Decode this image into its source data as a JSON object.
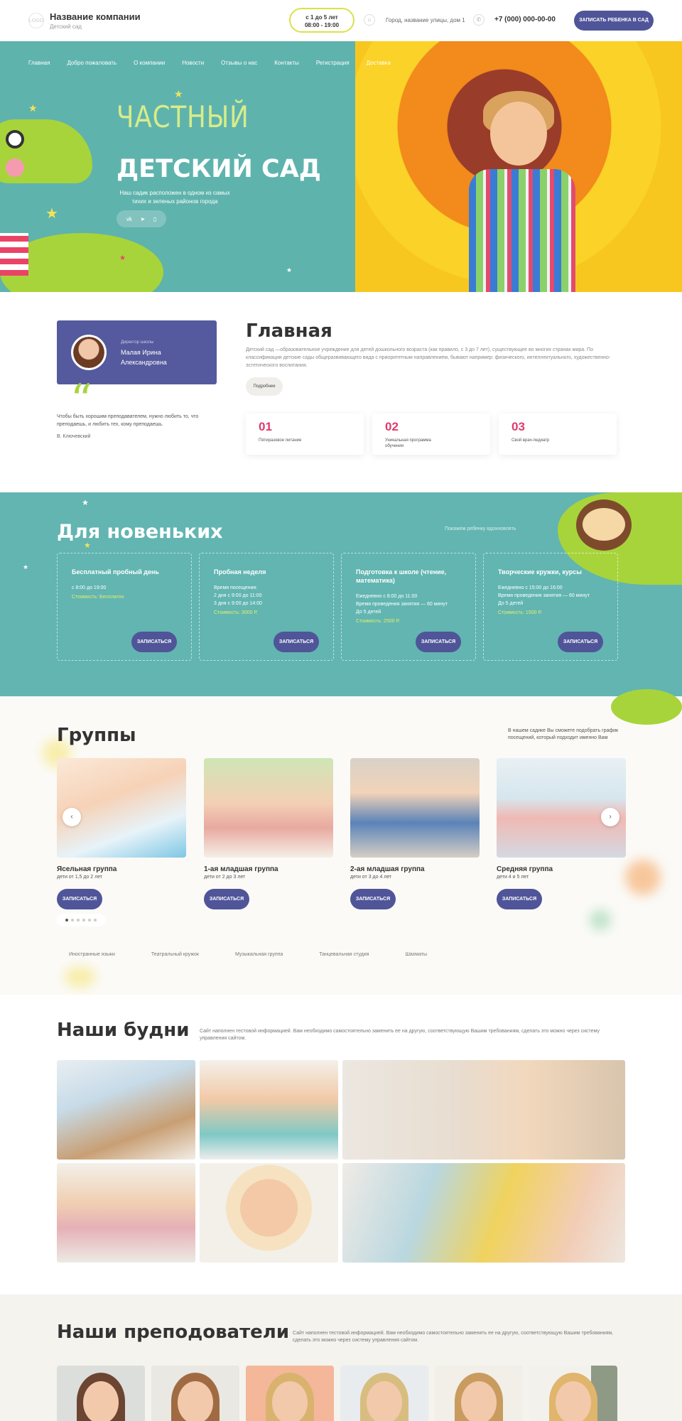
{
  "header": {
    "company_name": "Название компании",
    "company_sub": "Детский сад",
    "hours_line1": "с 1 до 5 лет",
    "hours_line2": "08:00 - 19:00",
    "address": "Город, название улицы, дом 1",
    "phone": "+7 (000) 000-00-00",
    "enroll_label": "ЗАПИСАТЬ РЕБЕНКА В САД"
  },
  "nav": [
    "Главная",
    "Добро пожаловать",
    "О компании",
    "Новости",
    "Отзывы о нас",
    "Контакты",
    "Регистрация",
    "Доставка"
  ],
  "hero": {
    "title_line1": "ЧАСТНЫЙ",
    "title_line2": "ДЕТСКИЙ САД",
    "description": "Наш садик расположен в одном из самых тихих и зеленых районов города",
    "socials": [
      "vk",
      "tg",
      "ig"
    ]
  },
  "director": {
    "role": "Директор школы",
    "name": "Малая Ирина Александровна",
    "quote": "Чтобы быть хорошим преподавателем, нужно любить то, что преподаешь, и любить тех, кому преподаешь.",
    "author": "В. Ключевский"
  },
  "main": {
    "title": "Главная",
    "text": "Детский сад —образовательное учреждение для детей дошкольного возраста (как правило, с 3 до 7 лет), существующее во многих странах мира. По классификации детские сады общеразвивающего вида с приоритетным направлением, бывают например: физического, интеллектуального, художественно-эстетического воспитания.",
    "more_label": "Подробнее",
    "features": [
      {
        "num": "01",
        "label": "Пятиразовое питание"
      },
      {
        "num": "02",
        "label": "Уникальная программа обучения"
      },
      {
        "num": "03",
        "label": "Свой врач-педиатр"
      }
    ]
  },
  "newcomers": {
    "title": "Для новеньких",
    "subtitle": "Покажем ребенку вдохновлять",
    "button_label": "ЗАПИСАТЬСЯ",
    "cards": [
      {
        "title": "Бесплатный пробный день",
        "details": "с 8:00 до 19:00",
        "price": "Стоимость: Бесплатно"
      },
      {
        "title": "Пробная неделя",
        "details": "Время посещения:\n2 дня с 9:00 до 11:00\n3 дня с 9:00 до 14:00",
        "price": "Стоимость: 3000 Р."
      },
      {
        "title": "Подготовка к школе (чтение, математика)",
        "details": "Ежедневно с 8:00 до 11:00\nВремя проведения занятия — 60 минут\nДо 5 детей",
        "price": "Стоимость: 2500 Р."
      },
      {
        "title": "Творческие кружки, курсы",
        "details": "Ежедневно с 15:00 до 16:00\nВремя проведения занятия — 60 минут\nДо 5 детей",
        "price": "Стоимость: 1500 Р."
      }
    ]
  },
  "groups": {
    "title": "Группы",
    "description": "В нашем садике Вы сможете подобрать график посещений, который подходит именно Вам",
    "button_label": "ЗАПИСАТЬСЯ",
    "items": [
      {
        "name": "Ясельная группа",
        "age": "дети от 1,5 до 2 лет"
      },
      {
        "name": "1-ая младшая группа",
        "age": "дети от 2 до 3 лет"
      },
      {
        "name": "2-ая младшая группа",
        "age": "дети от 3 до 4 лет"
      },
      {
        "name": "Средняя группа",
        "age": "дети 4 и 5 лет"
      }
    ],
    "clubs": [
      "Иностранные языки",
      "Театральный кружок",
      "Музыкальная группа",
      "Танцевальная студия",
      "Шахматы"
    ]
  },
  "everyday": {
    "title": "Наши будни",
    "description": "Сайт наполнен тестовой информацией. Вам необходимо самостоятельно заменить ее на другую, соответствующую Вашим требованиям, сделать это можно через систему управления сайтом."
  },
  "teachers": {
    "title": "Наши преподователи",
    "description": "Сайт наполнен тестовой информацией. Вам необходимо самостоятельно заменить ее на другую, соответствующую Вашим требованиям, сделать это можно через систему управления сайтом."
  },
  "colors": {
    "accent": "#4f5598",
    "teal": "#62b5b1",
    "lime": "#a8d43b",
    "pink": "#e03a6a",
    "yellow": "#d9e24a"
  }
}
